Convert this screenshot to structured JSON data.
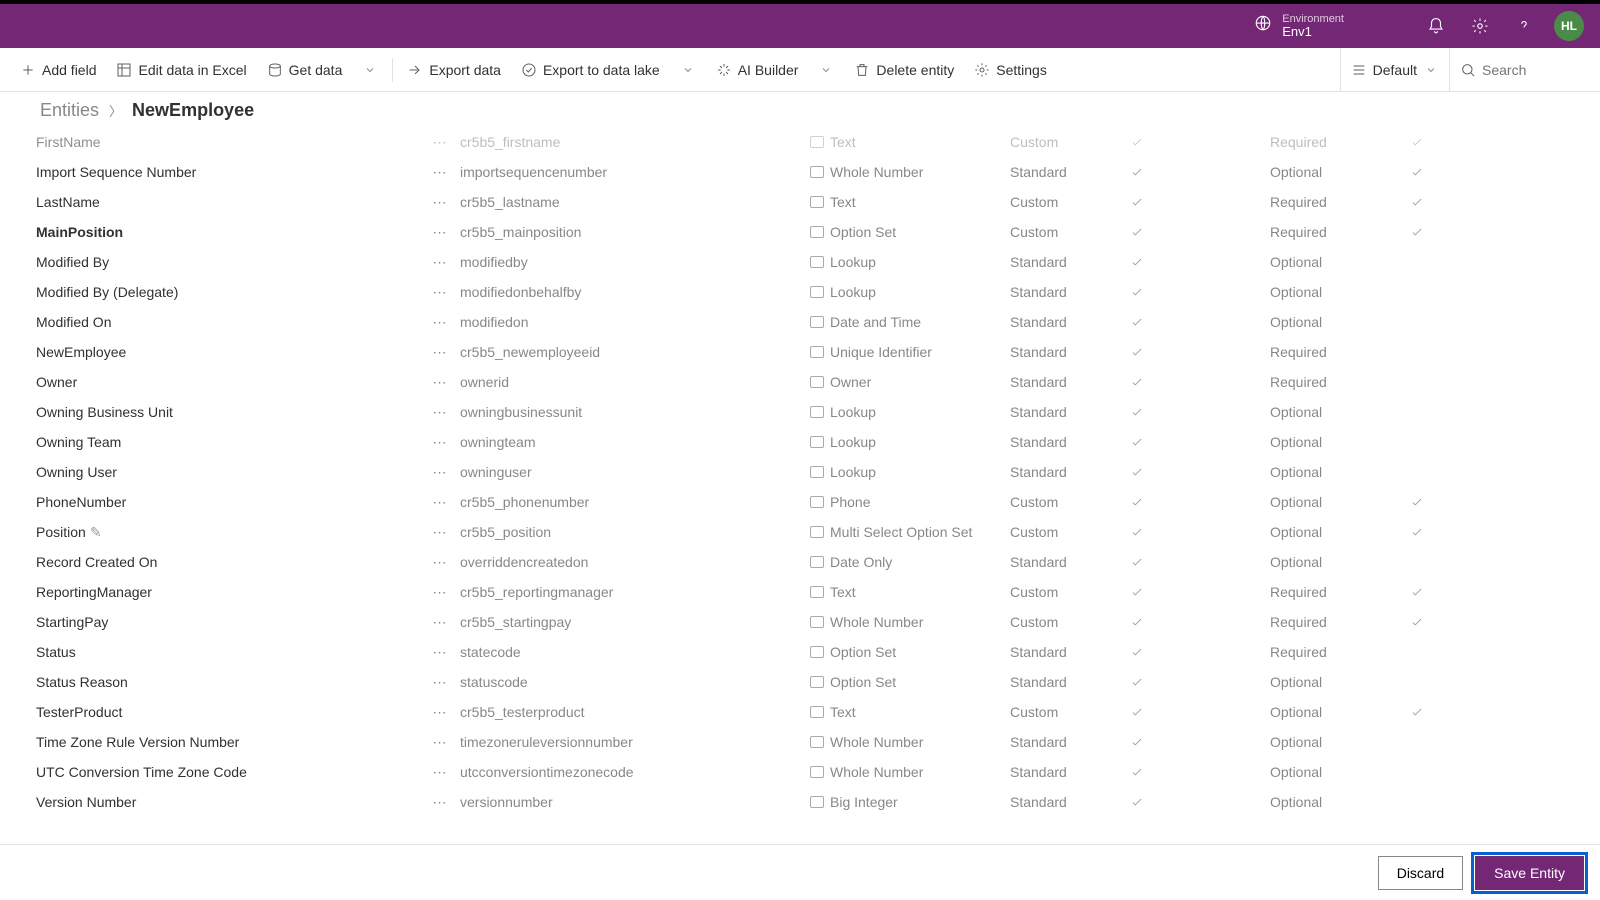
{
  "header": {
    "env_label": "Environment",
    "env_name": "Env1",
    "avatar_initials": "HL"
  },
  "toolbar": {
    "add_field": "Add field",
    "edit_excel": "Edit data in Excel",
    "get_data": "Get data",
    "export_data": "Export data",
    "export_lake": "Export to data lake",
    "ai_builder": "AI Builder",
    "delete_entity": "Delete entity",
    "settings": "Settings",
    "view_label": "Default",
    "search_placeholder": "Search"
  },
  "breadcrumb": {
    "parent": "Entities",
    "current": "NewEmployee"
  },
  "fields": [
    {
      "name": "FirstName",
      "schema": "cr5b5_firstname",
      "type": "Text",
      "kind": "Custom",
      "req": "Required",
      "faded": true,
      "check2": true
    },
    {
      "name": "Import Sequence Number",
      "schema": "importsequencenumber",
      "type": "Whole Number",
      "kind": "Standard",
      "req": "Optional",
      "check2": true
    },
    {
      "name": "LastName",
      "schema": "cr5b5_lastname",
      "type": "Text",
      "kind": "Custom",
      "req": "Required",
      "check2": true
    },
    {
      "name": "MainPosition",
      "schema": "cr5b5_mainposition",
      "type": "Option Set",
      "kind": "Custom",
      "req": "Required",
      "bold": true,
      "check2": true
    },
    {
      "name": "Modified By",
      "schema": "modifiedby",
      "type": "Lookup",
      "kind": "Standard",
      "req": "Optional"
    },
    {
      "name": "Modified By (Delegate)",
      "schema": "modifiedonbehalfby",
      "type": "Lookup",
      "kind": "Standard",
      "req": "Optional"
    },
    {
      "name": "Modified On",
      "schema": "modifiedon",
      "type": "Date and Time",
      "kind": "Standard",
      "req": "Optional"
    },
    {
      "name": "NewEmployee",
      "schema": "cr5b5_newemployeeid",
      "type": "Unique Identifier",
      "kind": "Standard",
      "req": "Required"
    },
    {
      "name": "Owner",
      "schema": "ownerid",
      "type": "Owner",
      "kind": "Standard",
      "req": "Required"
    },
    {
      "name": "Owning Business Unit",
      "schema": "owningbusinessunit",
      "type": "Lookup",
      "kind": "Standard",
      "req": "Optional"
    },
    {
      "name": "Owning Team",
      "schema": "owningteam",
      "type": "Lookup",
      "kind": "Standard",
      "req": "Optional"
    },
    {
      "name": "Owning User",
      "schema": "owninguser",
      "type": "Lookup",
      "kind": "Standard",
      "req": "Optional"
    },
    {
      "name": "PhoneNumber",
      "schema": "cr5b5_phonenumber",
      "type": "Phone",
      "kind": "Custom",
      "req": "Optional",
      "check2": true
    },
    {
      "name": "Position",
      "schema": "cr5b5_position",
      "type": "Multi Select Option Set",
      "kind": "Custom",
      "req": "Optional",
      "check2": true,
      "note": true
    },
    {
      "name": "Record Created On",
      "schema": "overriddencreatedon",
      "type": "Date Only",
      "kind": "Standard",
      "req": "Optional"
    },
    {
      "name": "ReportingManager",
      "schema": "cr5b5_reportingmanager",
      "type": "Text",
      "kind": "Custom",
      "req": "Required",
      "check2": true
    },
    {
      "name": "StartingPay",
      "schema": "cr5b5_startingpay",
      "type": "Whole Number",
      "kind": "Custom",
      "req": "Required",
      "check2": true
    },
    {
      "name": "Status",
      "schema": "statecode",
      "type": "Option Set",
      "kind": "Standard",
      "req": "Required"
    },
    {
      "name": "Status Reason",
      "schema": "statuscode",
      "type": "Option Set",
      "kind": "Standard",
      "req": "Optional"
    },
    {
      "name": "TesterProduct",
      "schema": "cr5b5_testerproduct",
      "type": "Text",
      "kind": "Custom",
      "req": "Optional",
      "check2": true
    },
    {
      "name": "Time Zone Rule Version Number",
      "schema": "timezoneruleversionnumber",
      "type": "Whole Number",
      "kind": "Standard",
      "req": "Optional"
    },
    {
      "name": "UTC Conversion Time Zone Code",
      "schema": "utcconversiontimezonecode",
      "type": "Whole Number",
      "kind": "Standard",
      "req": "Optional"
    },
    {
      "name": "Version Number",
      "schema": "versionnumber",
      "type": "Big Integer",
      "kind": "Standard",
      "req": "Optional"
    }
  ],
  "footer": {
    "discard": "Discard",
    "save": "Save Entity"
  }
}
